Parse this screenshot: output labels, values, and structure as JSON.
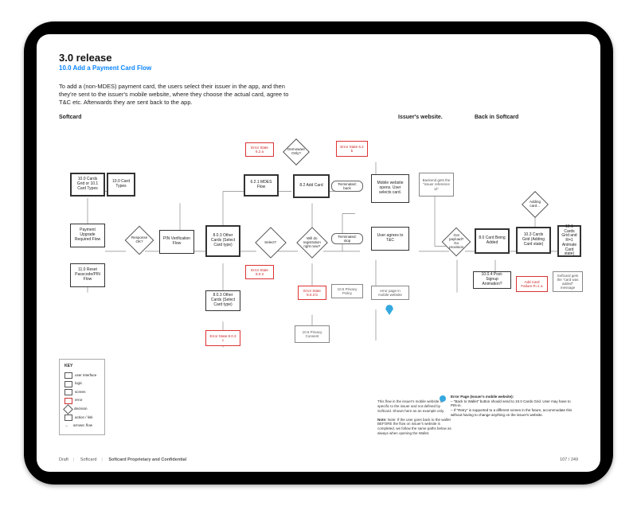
{
  "release": {
    "title": "3.0 release",
    "subtitle": "10.0 Add a Payment Card Flow"
  },
  "intro": "To add a (non-MDES) payment card, the users select their issuer in the app, and then they're sent to the issuer's mobile website, where they choose the actual card, agree to T&C etc. Afterwards they are sent back to the app.",
  "zones": {
    "softcard": "Softcard",
    "issuers": "Issuer's website.",
    "back": "Back in Softcard"
  },
  "nodes": {
    "start_a": "10.0 Cards Grid or 10.1 Card Types",
    "start_b": "10.0 Card Types",
    "upg": "Payment Upgrade Required Flow",
    "reset": "11.0 Reset Passcode/PIN Flow",
    "response": "Response OK?",
    "pin": "PIN Verification Flow",
    "other": "8.0.3 Other Cards (Select Card type)",
    "mdes": "6.2.1 MDES Flow",
    "addcard": "8.2 Add Card",
    "err_62": "Error State 6.2 a",
    "err_62b": "Error State 6.2 b",
    "err_803": "Error State 8.0.3",
    "err_803b": "Error State 8.0.3 b",
    "err_803c": "Error State 8.0.3 c",
    "other2": "8.0.3 Other Cards (Select Card type)",
    "reg": "Will do registration right now?",
    "dem": "Demoware Only?",
    "term_a": "Terminated: back",
    "term_b": "Terminated: stop",
    "priv": "10.5 Privacy Policy",
    "priv_b": "10.6 Privacy Consent",
    "issuer_box1": "Mobile website opens. User selects card.",
    "issuer_box2": "User agrees to T&C",
    "issuer_err": "error page in mobile website",
    "backend": "Backend gets the \"issuer reference id\"",
    "prov": "Got payload? Go provision",
    "cbn": "8.0 Card Being Added",
    "cancel": "10.0.4 Post-Signup Animation?",
    "cbv": "10.3 Cards Grid (Adding Card state)",
    "added": "Adding card…",
    "err_last": "Add Card Failure R=1 a",
    "final": "10.1 Cards Grid and R=1 Animate Card state)",
    "sc_done": "Softcard gets the \"card was added\" message"
  },
  "issuer_notes": {
    "p1": "This flow in the issuer's mobile website is specific to the issuer and not defined by Softcard. Shown here as an example only.",
    "p2": "Note: If the user goes back to the wallet BEFORE the flow on issuer's website is completed, we follow the same paths below as always when opening the Wallet."
  },
  "annotation": {
    "title": "Error Page (Issuer's mobile website):",
    "b1": "\"Back to Wallet\" button should send to 10.0 Cards Grid. User may have to PIN-in.",
    "b2": "If \"Retry\" is supported to a different screen in the future, accommodate this without having to change anything on the issuer's website."
  },
  "key": {
    "title": "KEY",
    "r1": "user interface",
    "r2": "logic",
    "r3": "screen",
    "r4": "error",
    "r5": "decision",
    "r6": "action / link",
    "r7": "arrows: flow"
  },
  "footer": {
    "doc": "Draft",
    "app": "Softcard",
    "conf": "Softcard Proprietary and Confidential",
    "page": "107 / 249"
  }
}
